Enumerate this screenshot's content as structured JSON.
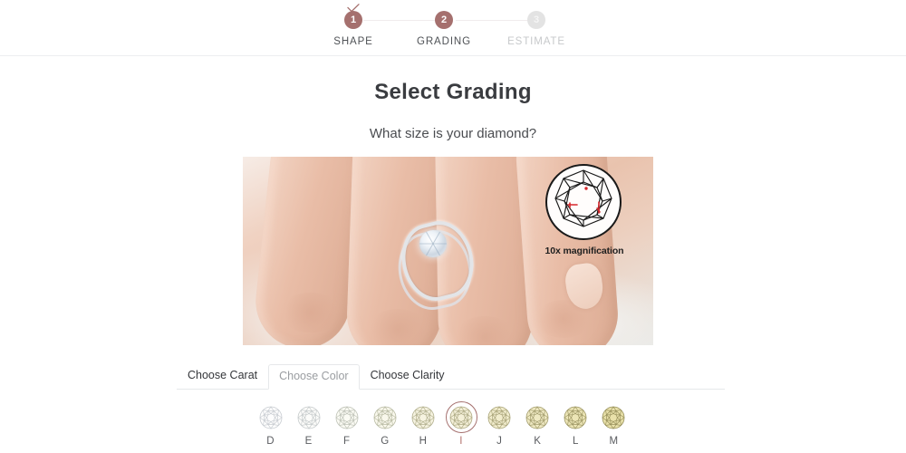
{
  "stepper": {
    "steps": [
      {
        "number": "1",
        "label": "SHAPE",
        "state": "done",
        "check_icon": "check-icon"
      },
      {
        "number": "2",
        "label": "GRADING",
        "state": "active",
        "check_icon": ""
      },
      {
        "number": "3",
        "label": "ESTIMATE",
        "state": "todo",
        "check_icon": ""
      }
    ]
  },
  "main": {
    "title": "Select Grading",
    "subtitle": "What size is your diamond?"
  },
  "hero": {
    "image_name": "diamond-ring-on-hand-photo",
    "magnifier_caption": "10x magnification",
    "magnifier_icon": "diamond-facet-diagram-icon"
  },
  "tabs": [
    {
      "label": "Choose Carat",
      "active": false,
      "name": "tab-choose-carat"
    },
    {
      "label": "Choose Color",
      "active": true,
      "name": "tab-choose-color"
    },
    {
      "label": "Choose Clarity",
      "active": false,
      "name": "tab-choose-clarity"
    }
  ],
  "color_grades": [
    {
      "label": "D",
      "selected": false,
      "tint": "#fdfdfd",
      "edge": "#c9cdd2"
    },
    {
      "label": "E",
      "selected": false,
      "tint": "#fcfcfa",
      "edge": "#c6cbcc"
    },
    {
      "label": "F",
      "selected": false,
      "tint": "#fbfbf4",
      "edge": "#bfc3b8"
    },
    {
      "label": "G",
      "selected": false,
      "tint": "#f9f8ec",
      "edge": "#b9bba4"
    },
    {
      "label": "H",
      "selected": false,
      "tint": "#f6f3e0",
      "edge": "#b3b190"
    },
    {
      "label": "I",
      "selected": true,
      "tint": "#f4f0d8",
      "edge": "#aeaa85"
    },
    {
      "label": "J",
      "selected": false,
      "tint": "#f2edcd",
      "edge": "#a9a479"
    },
    {
      "label": "K",
      "selected": false,
      "tint": "#efe9c2",
      "edge": "#a39d6e"
    },
    {
      "label": "L",
      "selected": false,
      "tint": "#ece5b6",
      "edge": "#9e9765"
    },
    {
      "label": "M",
      "selected": false,
      "tint": "#e9e1aa",
      "edge": "#98915c"
    }
  ],
  "colors": {
    "accent": "#a5706e",
    "selected_label": "#b2706c",
    "inactive_step": "#e3e3e3",
    "border": "#e6e8ea",
    "text": "#3f4145"
  }
}
